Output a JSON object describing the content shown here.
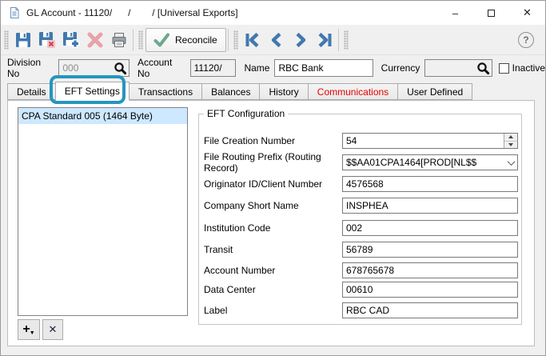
{
  "titlebar": {
    "title": "GL Account - 11120/      /        / [Universal Exports]",
    "minimize_glyph": "–",
    "close_glyph": "✕"
  },
  "toolbar": {
    "icons": [
      "save",
      "save-discard",
      "save-new",
      "delete",
      "print",
      "first-record",
      "previous-record",
      "next-record",
      "last-record"
    ],
    "reconcile_label": "Reconcile",
    "help_glyph": "?"
  },
  "header": {
    "division": {
      "label": "Division No",
      "value": "000"
    },
    "account": {
      "label": "Account No",
      "value": "11120/"
    },
    "name": {
      "label": "Name",
      "value": "RBC Bank"
    },
    "currency": {
      "label": "Currency",
      "value": ""
    },
    "inactive": {
      "label": "Inactive",
      "checked": false
    }
  },
  "tabs": [
    {
      "label": "Details"
    },
    {
      "label": "EFT Settings"
    },
    {
      "label": "Transactions"
    },
    {
      "label": "Balances"
    },
    {
      "label": "History"
    },
    {
      "label": "Communications"
    },
    {
      "label": "User Defined"
    }
  ],
  "active_tab": "EFT Settings",
  "eft_panel": {
    "format_list": [
      {
        "label": "CPA Standard 005 (1464 Byte)",
        "selected": true
      }
    ],
    "group_title": "EFT Configuration",
    "fields": [
      {
        "label": "File Creation Number",
        "value": "54",
        "control": "spinner"
      },
      {
        "label": "File Routing Prefix (Routing Record)",
        "value": "$$AA01CPA1464[PROD[NL$$",
        "control": "combobox"
      },
      {
        "label": "Originator ID/Client Number",
        "value": "4576568",
        "control": "text"
      },
      {
        "label": "Company Short Name",
        "value": "INSPHEA",
        "control": "text"
      },
      {
        "label": "Institution Code",
        "value": "002",
        "control": "text"
      },
      {
        "label": "Transit",
        "value": "56789",
        "control": "text"
      },
      {
        "label": "Account Number",
        "value": "678765678",
        "control": "text"
      },
      {
        "label": "Data Center",
        "value": "00610",
        "control": "text"
      },
      {
        "label": "Label",
        "value": "RBC CAD",
        "control": "text"
      }
    ],
    "add_button_glyph": "+",
    "remove_button_glyph": "✕"
  },
  "colors": {
    "accent_blue": "#4179ad",
    "annotation_teal": "#2596be",
    "communications_red": "#e60000",
    "selection_blue": "#cde8ff",
    "reconcile_green": "#6fa78c",
    "disabled_pink": "#e8a2aa"
  }
}
